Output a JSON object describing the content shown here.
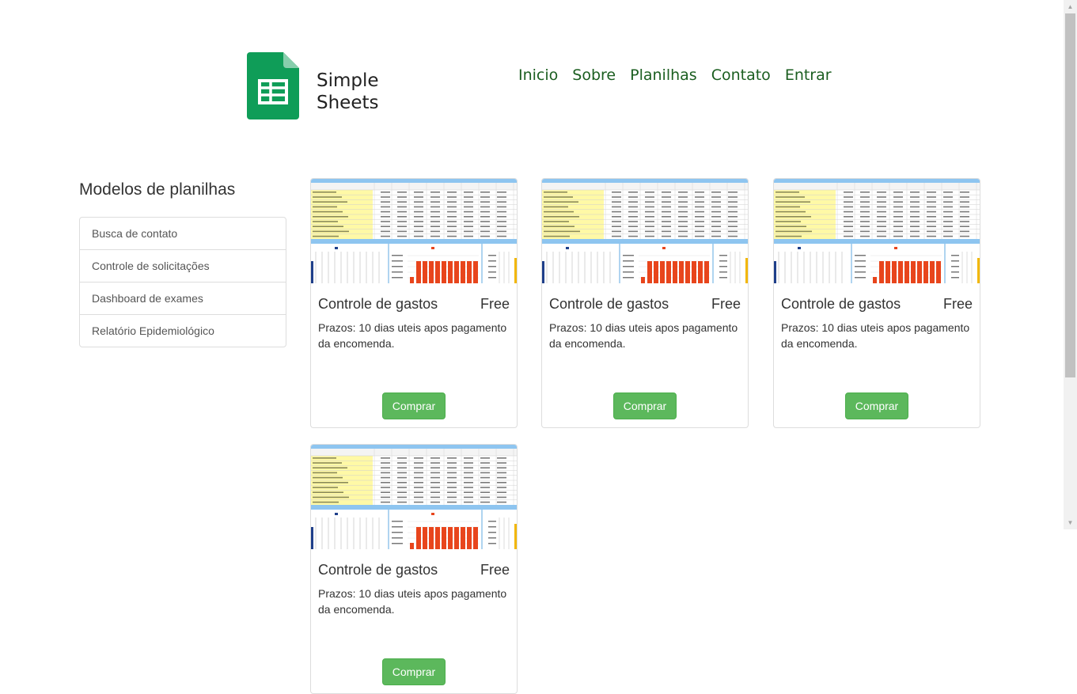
{
  "brand": {
    "line1": "Simple",
    "line2": "Sheets"
  },
  "nav": [
    "Inicio",
    "Sobre",
    "Planilhas",
    "Contato",
    "Entrar"
  ],
  "sidebar": {
    "title": "Modelos de planilhas",
    "items": [
      "Busca de contato",
      "Controle de solicitações",
      "Dashboard de exames",
      "Relatório Epidemiológico"
    ]
  },
  "products": [
    {
      "title": "Controle de gastos",
      "price": "Free",
      "description": "Prazos: 10 dias uteis apos pagamento da encomenda.",
      "button": "Comprar"
    },
    {
      "title": "Controle de gastos",
      "price": "Free",
      "description": "Prazos: 10 dias uteis apos pagamento da encomenda.",
      "button": "Comprar"
    },
    {
      "title": "Controle de gastos",
      "price": "Free",
      "description": "Prazos: 10 dias uteis apos pagamento da encomenda.",
      "button": "Comprar"
    },
    {
      "title": "Controle de gastos",
      "price": "Free",
      "description": "Prazos: 10 dias uteis apos pagamento da encomenda.",
      "button": "Comprar"
    }
  ],
  "colors": {
    "logo_green": "#0f9d58",
    "nav_link": "#1b5e20",
    "button_green": "#5cb85c",
    "bar_red": "#e8451c",
    "header_blue": "#8ec5f0",
    "cell_yellow": "#fff9a6"
  },
  "icons": {
    "logo": "spreadsheet-icon"
  }
}
